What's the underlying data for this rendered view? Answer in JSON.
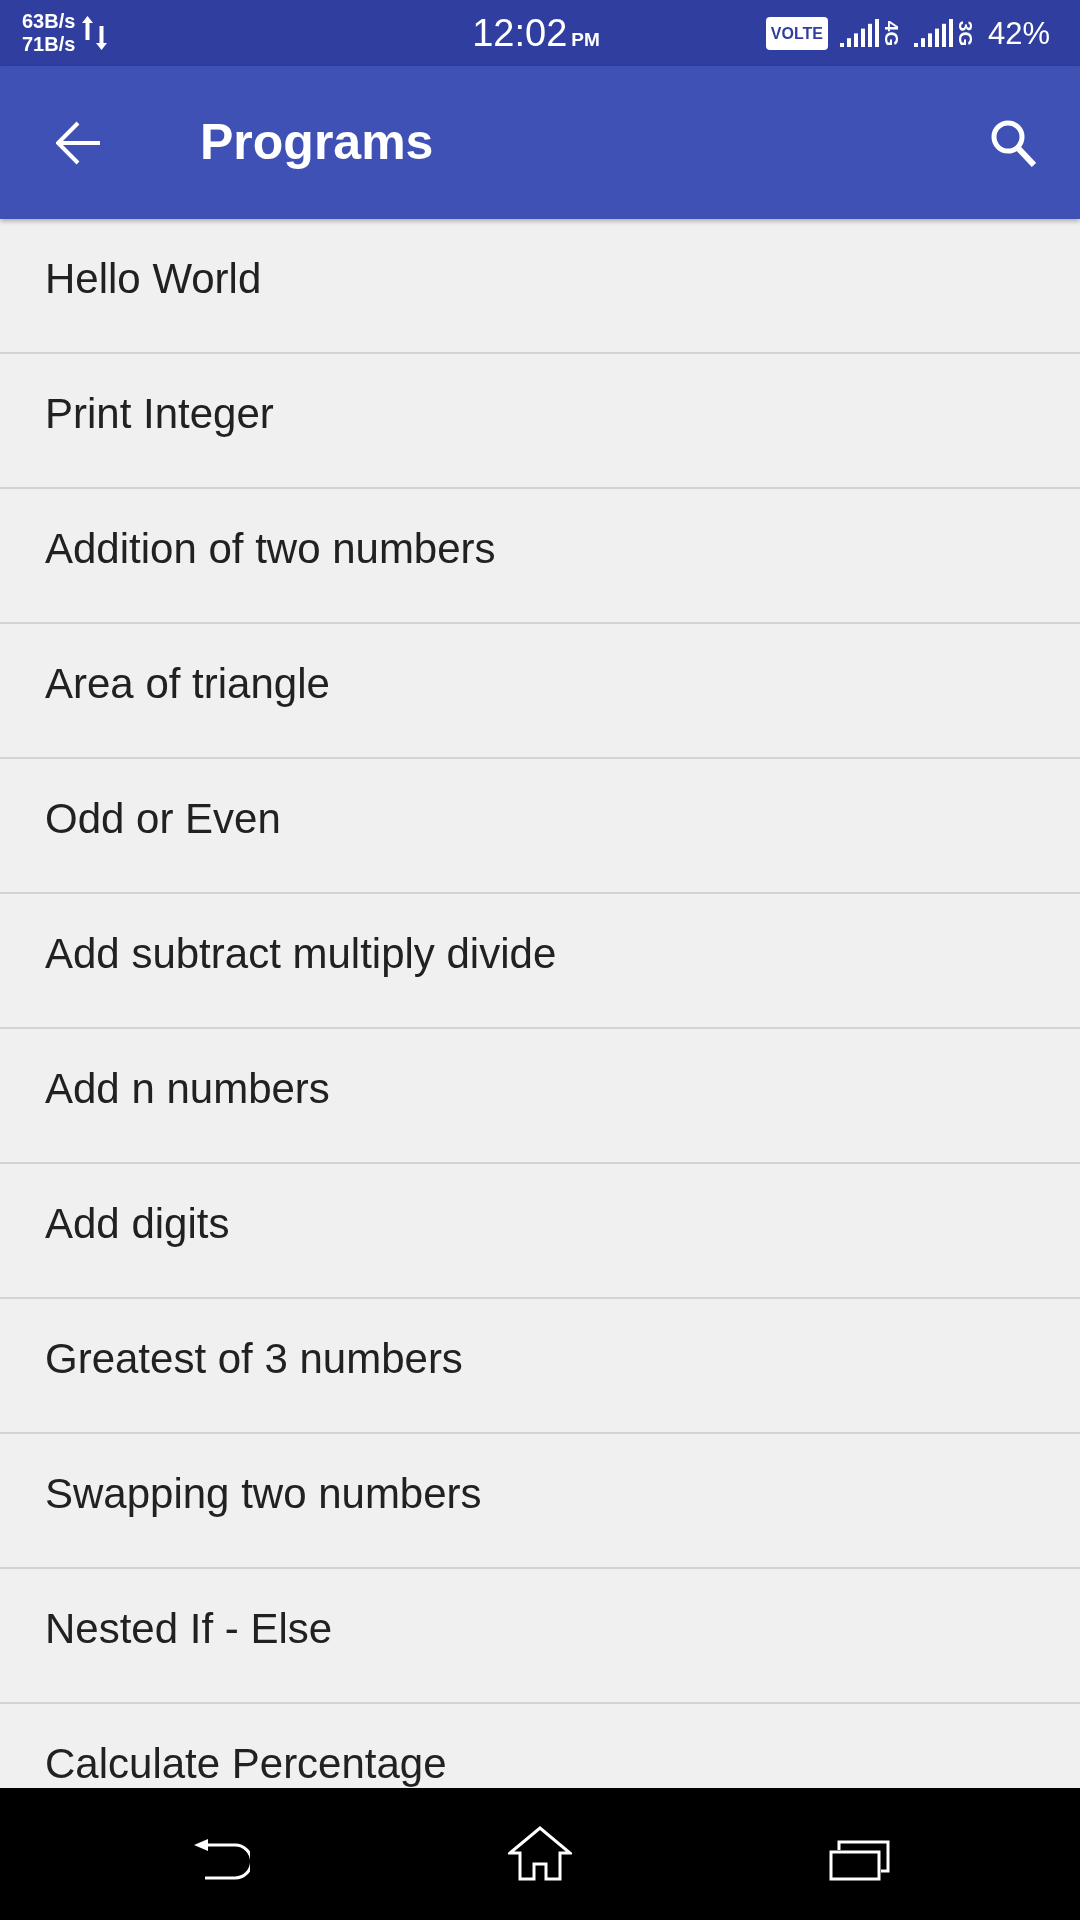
{
  "status_bar": {
    "upload_speed": "63B/s",
    "download_speed": "71B/s",
    "time": "12:02",
    "time_period": "PM",
    "volte_badge": "VOLTE",
    "networks": [
      "4G",
      "3G"
    ],
    "battery": "42%"
  },
  "app_bar": {
    "title": "Programs"
  },
  "programs": [
    "Hello World",
    "Print Integer",
    "Addition of two numbers",
    "Area of triangle",
    "Odd or Even",
    "Add subtract multiply divide",
    "Add n numbers",
    "Add digits",
    "Greatest of 3 numbers",
    "Swapping two numbers",
    "Nested If - Else",
    "Calculate Percentage"
  ]
}
